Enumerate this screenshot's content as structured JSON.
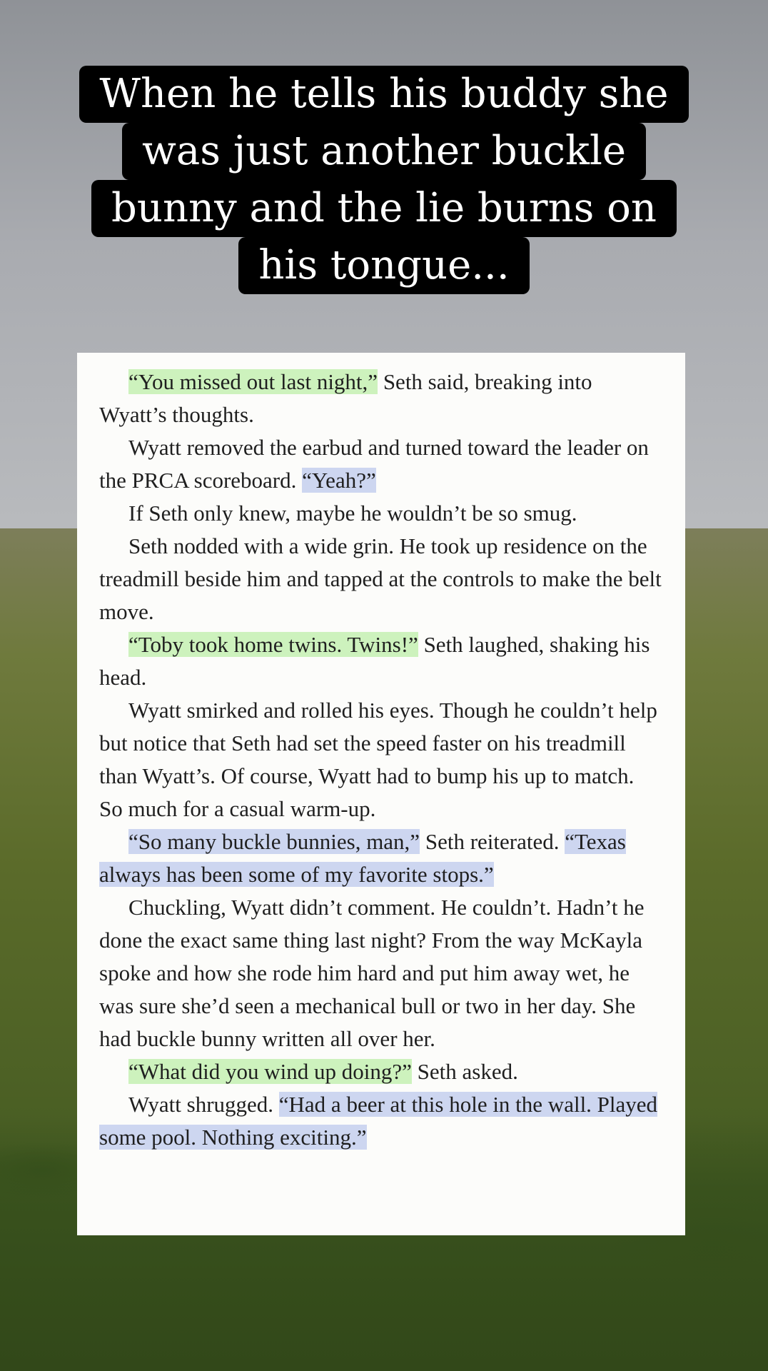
{
  "title": {
    "lines": [
      "When he tells his buddy she",
      "was just another buckle",
      "bunny and the lie burns on",
      "his tongue..."
    ]
  },
  "excerpt": {
    "paragraphs": [
      {
        "highlight": "“You missed out last night,”",
        "highlight_color": "green",
        "text": " Seth said, breaking into Wyatt’s thoughts."
      },
      {
        "text": "Wyatt removed the earbud and turned toward the leader on the PRCA scoreboard. ",
        "highlight_after": "“Yeah?”",
        "highlight_after_color": "blue"
      },
      {
        "text": "If Seth only knew, maybe he wouldn’t be so smug."
      },
      {
        "text": "Seth nodded with a wide grin. He took up residence on the treadmill beside him and tapped at the controls to make the belt move."
      },
      {
        "highlight": "“Toby took home twins. Twins!”",
        "highlight_color": "green",
        "text": " Seth laughed, shaking his head."
      },
      {
        "text": "Wyatt smirked and rolled his eyes. Though he couldn’t help but notice that Seth had set the speed faster on his treadmill than Wyatt’s. Of course, Wyatt had to bump his up to match. So much for a casual warm-up."
      },
      {
        "highlight": "“So many buckle bunnies, man,”",
        "highlight_color": "blue",
        "text": " Seth reiterated. ",
        "highlight_after": "“Texas always has been some of my favorite stops.”",
        "highlight_after_color": "blue"
      },
      {
        "text": "Chuckling, Wyatt didn’t comment. He couldn’t. Hadn’t he done the exact same thing last night? From the way McKayla spoke and how she rode him hard and put him away wet, he was sure she’d seen a mechanical bull or two in her day. She had buckle bunny written all over her."
      },
      {
        "highlight": "“What did you wind up doing?”",
        "highlight_color": "green",
        "text": " Seth asked."
      },
      {
        "text": "Wyatt shrugged. ",
        "highlight_after": "“Had a beer at this hole in the wall. Played some pool. Nothing exciting.”",
        "highlight_after_color": "blue"
      }
    ]
  },
  "colors": {
    "highlight_green": "#cdf2bd",
    "highlight_blue": "#cdd6f0",
    "title_bg": "#000000",
    "title_text": "#ffffff"
  }
}
